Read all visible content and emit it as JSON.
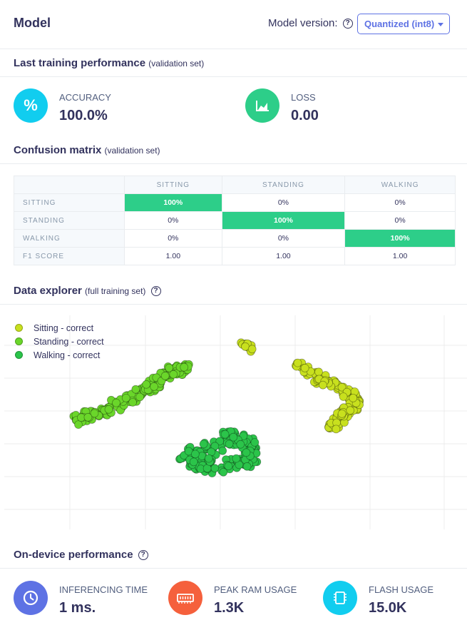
{
  "header": {
    "title": "Model",
    "model_version_label": "Model version:",
    "model_version_selected": "Quantized (int8)"
  },
  "training": {
    "heading": "Last training performance",
    "heading_sub": "(validation set)",
    "accuracy": {
      "label": "ACCURACY",
      "value": "100.0%",
      "icon": "percent-icon",
      "color": "#11cdef"
    },
    "loss": {
      "label": "LOSS",
      "value": "0.00",
      "icon": "chart-area-icon",
      "color": "#2dce89"
    }
  },
  "confusion": {
    "heading": "Confusion matrix",
    "heading_sub": "(validation set)",
    "columns": [
      "SITTING",
      "STANDING",
      "WALKING"
    ],
    "rows": [
      {
        "label": "SITTING",
        "cells": [
          "100%",
          "0%",
          "0%"
        ]
      },
      {
        "label": "STANDING",
        "cells": [
          "0%",
          "100%",
          "0%"
        ]
      },
      {
        "label": "WALKING",
        "cells": [
          "0%",
          "0%",
          "100%"
        ]
      }
    ],
    "f1_label": "F1 SCORE",
    "f1": [
      "1.00",
      "1.00",
      "1.00"
    ],
    "hit_color": "#2dce89"
  },
  "explorer": {
    "heading": "Data explorer",
    "heading_sub": "(full training set)",
    "legend": [
      {
        "label": "Sitting - correct",
        "color": "#c8e01e"
      },
      {
        "label": "Standing - correct",
        "color": "#6ad62a"
      },
      {
        "label": "Walking - correct",
        "color": "#2bc44a"
      }
    ]
  },
  "ondevice": {
    "heading": "On-device performance",
    "inferencing": {
      "label": "INFERENCING TIME",
      "value": "1 ms.",
      "icon": "clock-icon",
      "color": "#5e72e4"
    },
    "ram": {
      "label": "PEAK RAM USAGE",
      "value": "1.3K",
      "icon": "memory-icon",
      "color": "#f5603c"
    },
    "flash": {
      "label": "FLASH USAGE",
      "value": "15.0K",
      "icon": "chip-icon",
      "color": "#11cdef"
    }
  }
}
